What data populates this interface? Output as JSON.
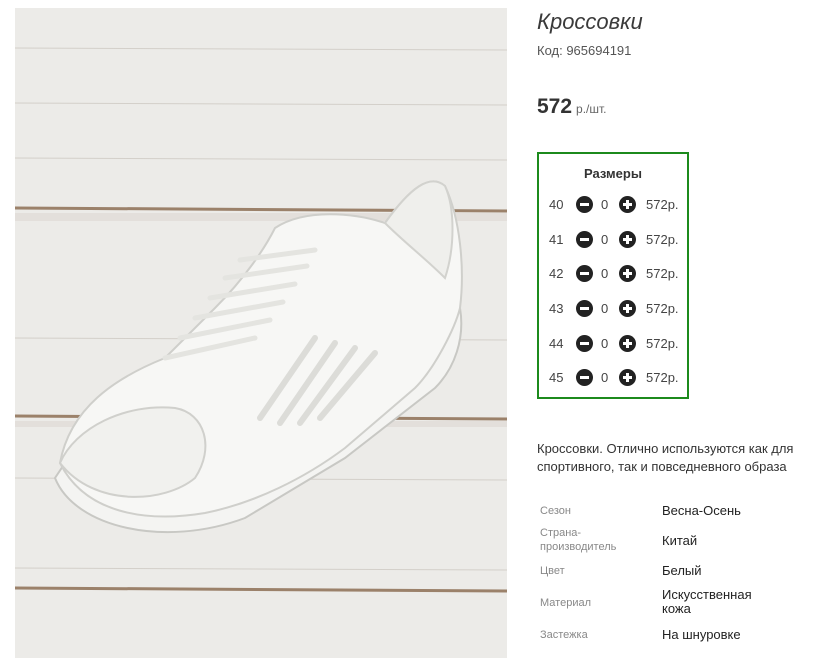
{
  "product": {
    "title": "Кроссовки",
    "sku": "Код: 965694191",
    "price": {
      "amount": "572",
      "unit": "р./шт."
    },
    "image_alt_icon": "product-photo"
  },
  "sizes": {
    "title": "Размеры",
    "rows": [
      {
        "size": "40",
        "qty": "0",
        "price": "572р."
      },
      {
        "size": "41",
        "qty": "0",
        "price": "572р."
      },
      {
        "size": "42",
        "qty": "0",
        "price": "572р."
      },
      {
        "size": "43",
        "qty": "0",
        "price": "572р."
      },
      {
        "size": "44",
        "qty": "0",
        "price": "572р."
      },
      {
        "size": "45",
        "qty": "0",
        "price": "572р."
      }
    ],
    "icons": {
      "minus": "minus-circle-icon",
      "plus": "plus-circle-icon"
    }
  },
  "description": "Кроссовки. Отлично используются как для спортивного, так и повседневного образа",
  "attributes": [
    {
      "label": "Сезон",
      "value": "Весна-Осень"
    },
    {
      "label": "Страна-\nпроизводитель",
      "value": "Китай"
    },
    {
      "label": "Цвет",
      "value": "Белый"
    },
    {
      "label": "Материал",
      "value": "Искусственная\nкожа"
    },
    {
      "label": "Застежка",
      "value": "На шнуровке"
    }
  ],
  "colors": {
    "accent_border": "#1c8a1c",
    "button": "#222222"
  }
}
